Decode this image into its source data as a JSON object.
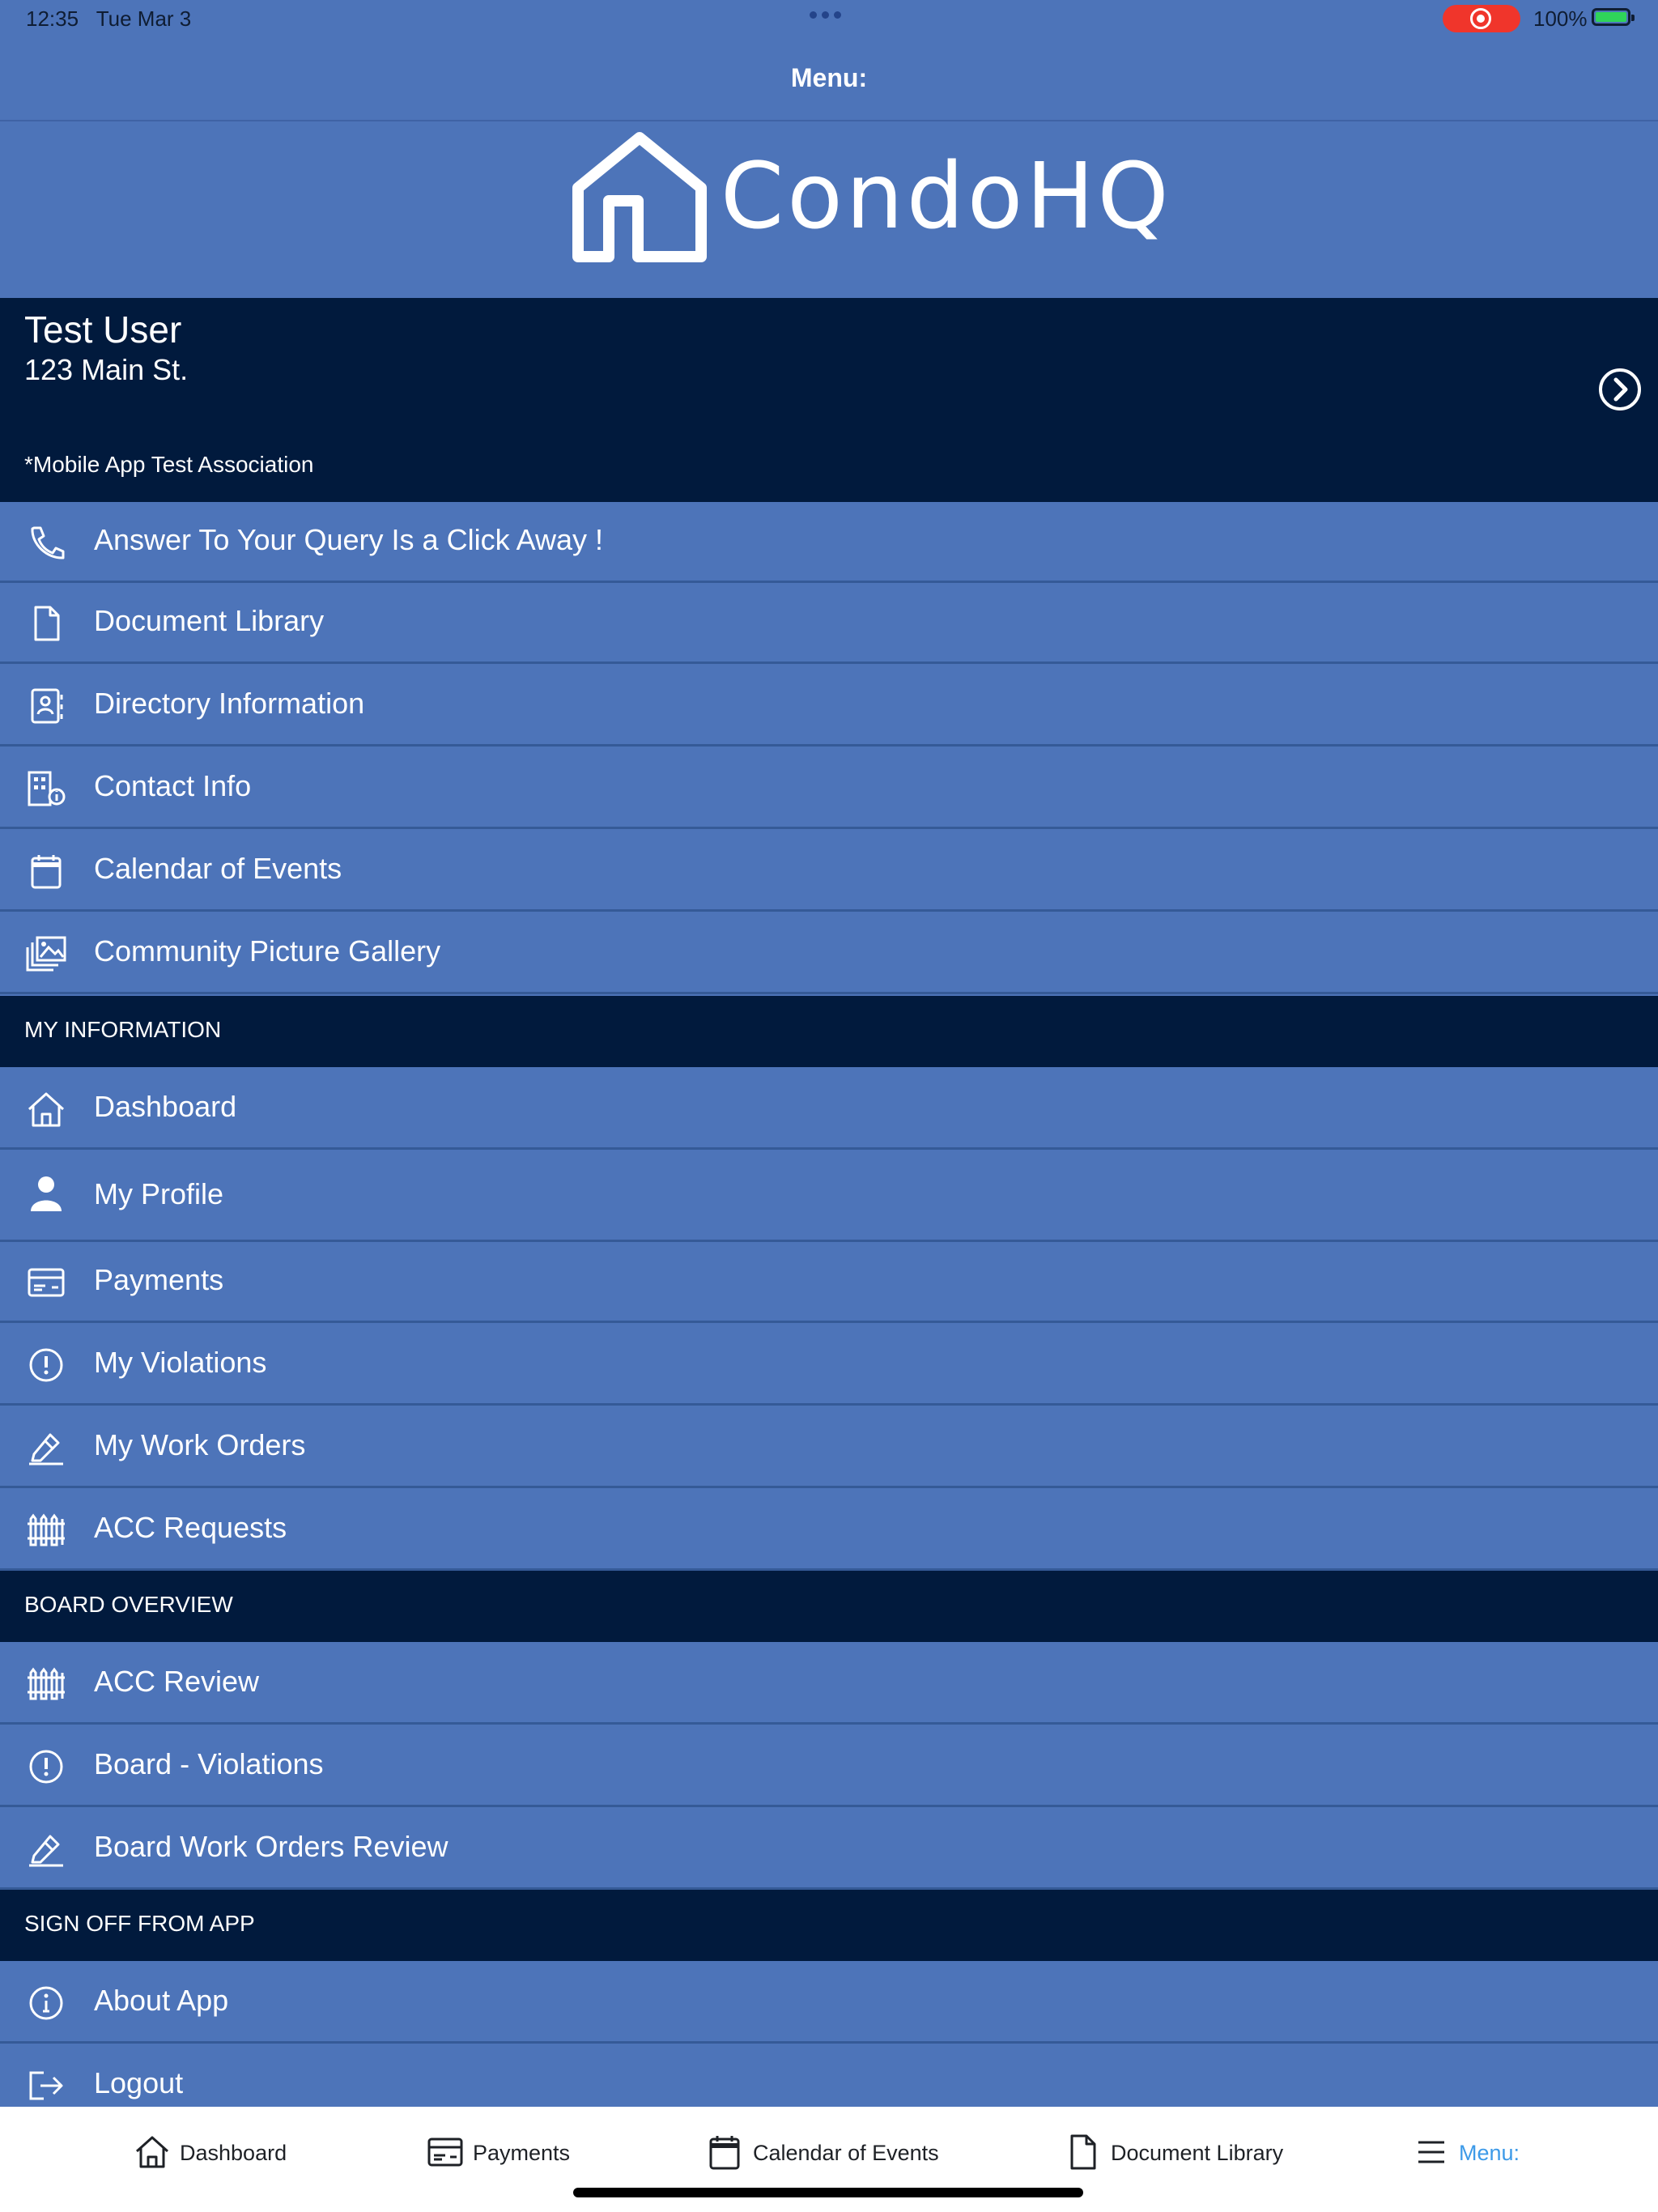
{
  "status_bar": {
    "time": "12:35",
    "date": "Tue Mar 3",
    "battery": "100%"
  },
  "nav": {
    "title": "Menu:"
  },
  "brand": {
    "name": "CondoHQ"
  },
  "user": {
    "name": "Test User",
    "address": "123 Main St."
  },
  "association": "*Mobile App Test Association",
  "association_items": [
    {
      "label": "Answer To Your Query Is a Click Away !",
      "icon": "phone-icon"
    },
    {
      "label": "Document Library",
      "icon": "document-icon"
    },
    {
      "label": "Directory Information",
      "icon": "directory-icon"
    },
    {
      "label": "Contact Info",
      "icon": "building-info-icon"
    },
    {
      "label": "Calendar of Events",
      "icon": "calendar-icon"
    },
    {
      "label": "Community Picture Gallery",
      "icon": "gallery-icon"
    }
  ],
  "my_information": {
    "header": "MY INFORMATION",
    "items": [
      {
        "label": "Dashboard",
        "icon": "home-icon"
      },
      {
        "label": "My Profile",
        "icon": "person-icon"
      },
      {
        "label": "Payments",
        "icon": "payment-card-icon"
      },
      {
        "label": "My Violations",
        "icon": "alert-icon"
      },
      {
        "label": "My Work Orders",
        "icon": "work-order-icon"
      },
      {
        "label": "ACC Requests",
        "icon": "fence-icon"
      }
    ]
  },
  "board_overview": {
    "header": "BOARD OVERVIEW",
    "items": [
      {
        "label": "ACC Review",
        "icon": "fence-icon"
      },
      {
        "label": "Board - Violations",
        "icon": "alert-icon"
      },
      {
        "label": "Board Work Orders Review",
        "icon": "work-order-icon"
      }
    ]
  },
  "sign_off": {
    "header": "SIGN OFF FROM APP",
    "items": [
      {
        "label": "About App",
        "icon": "info-icon"
      },
      {
        "label": "Logout",
        "icon": "logout-icon"
      }
    ]
  },
  "tabs": [
    {
      "label": "Dashboard",
      "icon": "home-icon"
    },
    {
      "label": "Payments",
      "icon": "payment-card-icon"
    },
    {
      "label": "Calendar of Events",
      "icon": "calendar-icon"
    },
    {
      "label": "Document Library",
      "icon": "document-icon"
    },
    {
      "label": "Menu:",
      "icon": "hamburger-icon",
      "active": true
    }
  ],
  "colors": {
    "background": "#4d74b9",
    "dark_navy": "#011a3d",
    "active_tab": "#3d9ae8",
    "record_red": "#f0352b",
    "battery_green": "#2fd45a"
  }
}
